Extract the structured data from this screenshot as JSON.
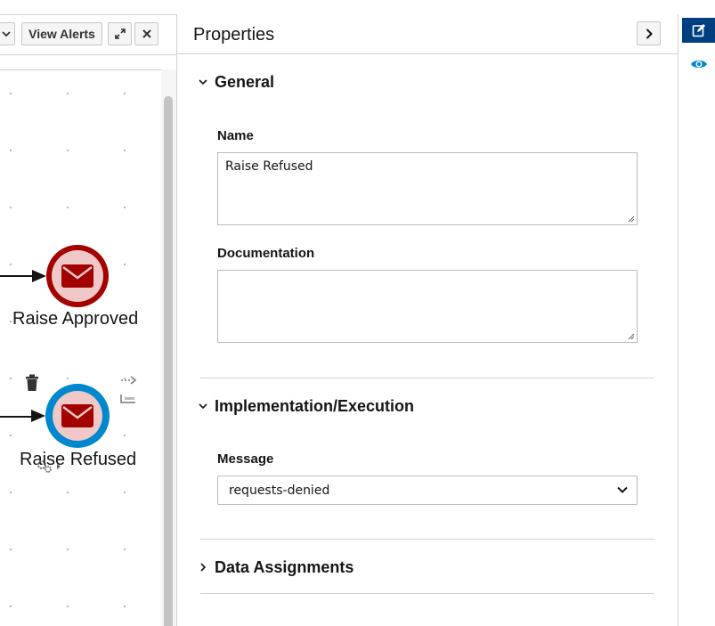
{
  "toolbar": {
    "view_alerts_label": "View Alerts",
    "expand_icon": "expand-icon",
    "close_icon": "close-icon"
  },
  "canvas": {
    "nodes": [
      {
        "label": "Raise Approved",
        "type": "end-message-event",
        "ring_color": "#a30000",
        "icon_color": "#a30000",
        "selected": false
      },
      {
        "label": "Raise Refused",
        "type": "end-message-event",
        "ring_color": "#0088ce",
        "icon_color": "#a30000",
        "selected": true
      }
    ]
  },
  "properties": {
    "title": "Properties",
    "sections": {
      "general": "General",
      "implementation": "Implementation/Execution",
      "data_assignments": "Data Assignments"
    },
    "fields": {
      "name_label": "Name",
      "name_value": "Raise Refused",
      "documentation_label": "Documentation",
      "documentation_value": "",
      "message_label": "Message",
      "message_value": "requests-denied"
    }
  },
  "rail": {
    "edit_icon": "edit-icon",
    "preview_icon": "eye-icon",
    "active_color": "#004080"
  }
}
